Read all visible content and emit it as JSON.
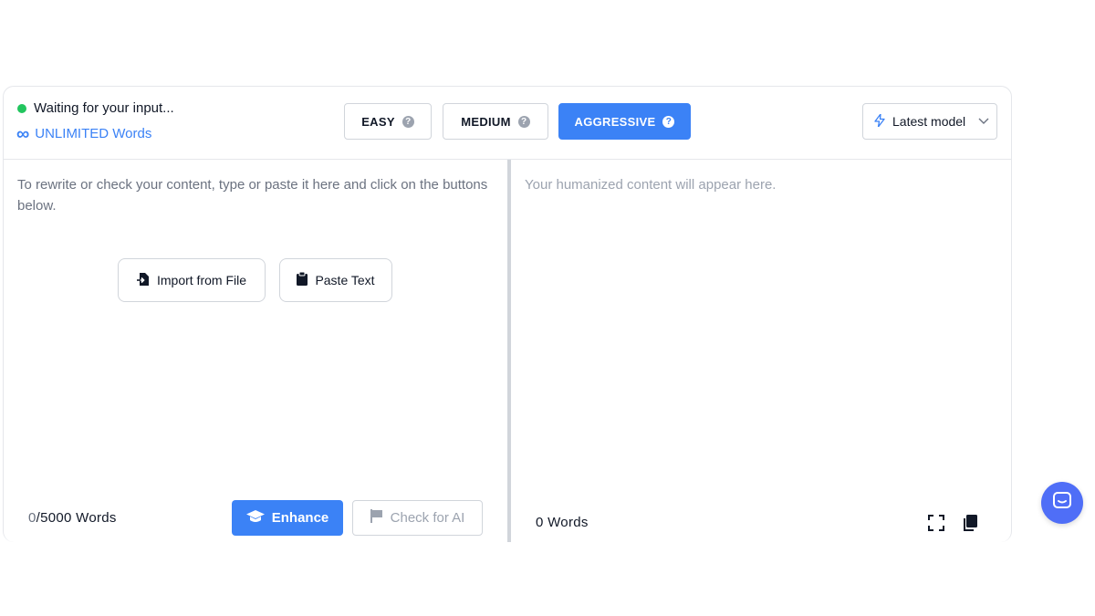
{
  "status": {
    "text": "Waiting for your input...",
    "color": "#22c55e"
  },
  "plan": {
    "icon": "infinity-icon",
    "text": "UNLIMITED Words"
  },
  "modes": [
    {
      "label": "EASY",
      "active": false
    },
    {
      "label": "MEDIUM",
      "active": false
    },
    {
      "label": "AGGRESSIVE",
      "active": true
    }
  ],
  "model_select": {
    "icon": "bolt-icon",
    "value": "Latest model"
  },
  "input_pane": {
    "placeholder": "To rewrite or check your content, type or paste it here and click on the buttons below.",
    "import_label": "Import from File",
    "paste_label": "Paste Text",
    "count_current": "0",
    "count_limit": "/5000 Words",
    "enhance_label": "Enhance",
    "check_label": "Check for AI"
  },
  "output_pane": {
    "placeholder": "Your humanized content will appear here.",
    "word_count": "0 Words"
  },
  "colors": {
    "accent": "#3b82f6",
    "chat_button": "#4f6ef7"
  }
}
